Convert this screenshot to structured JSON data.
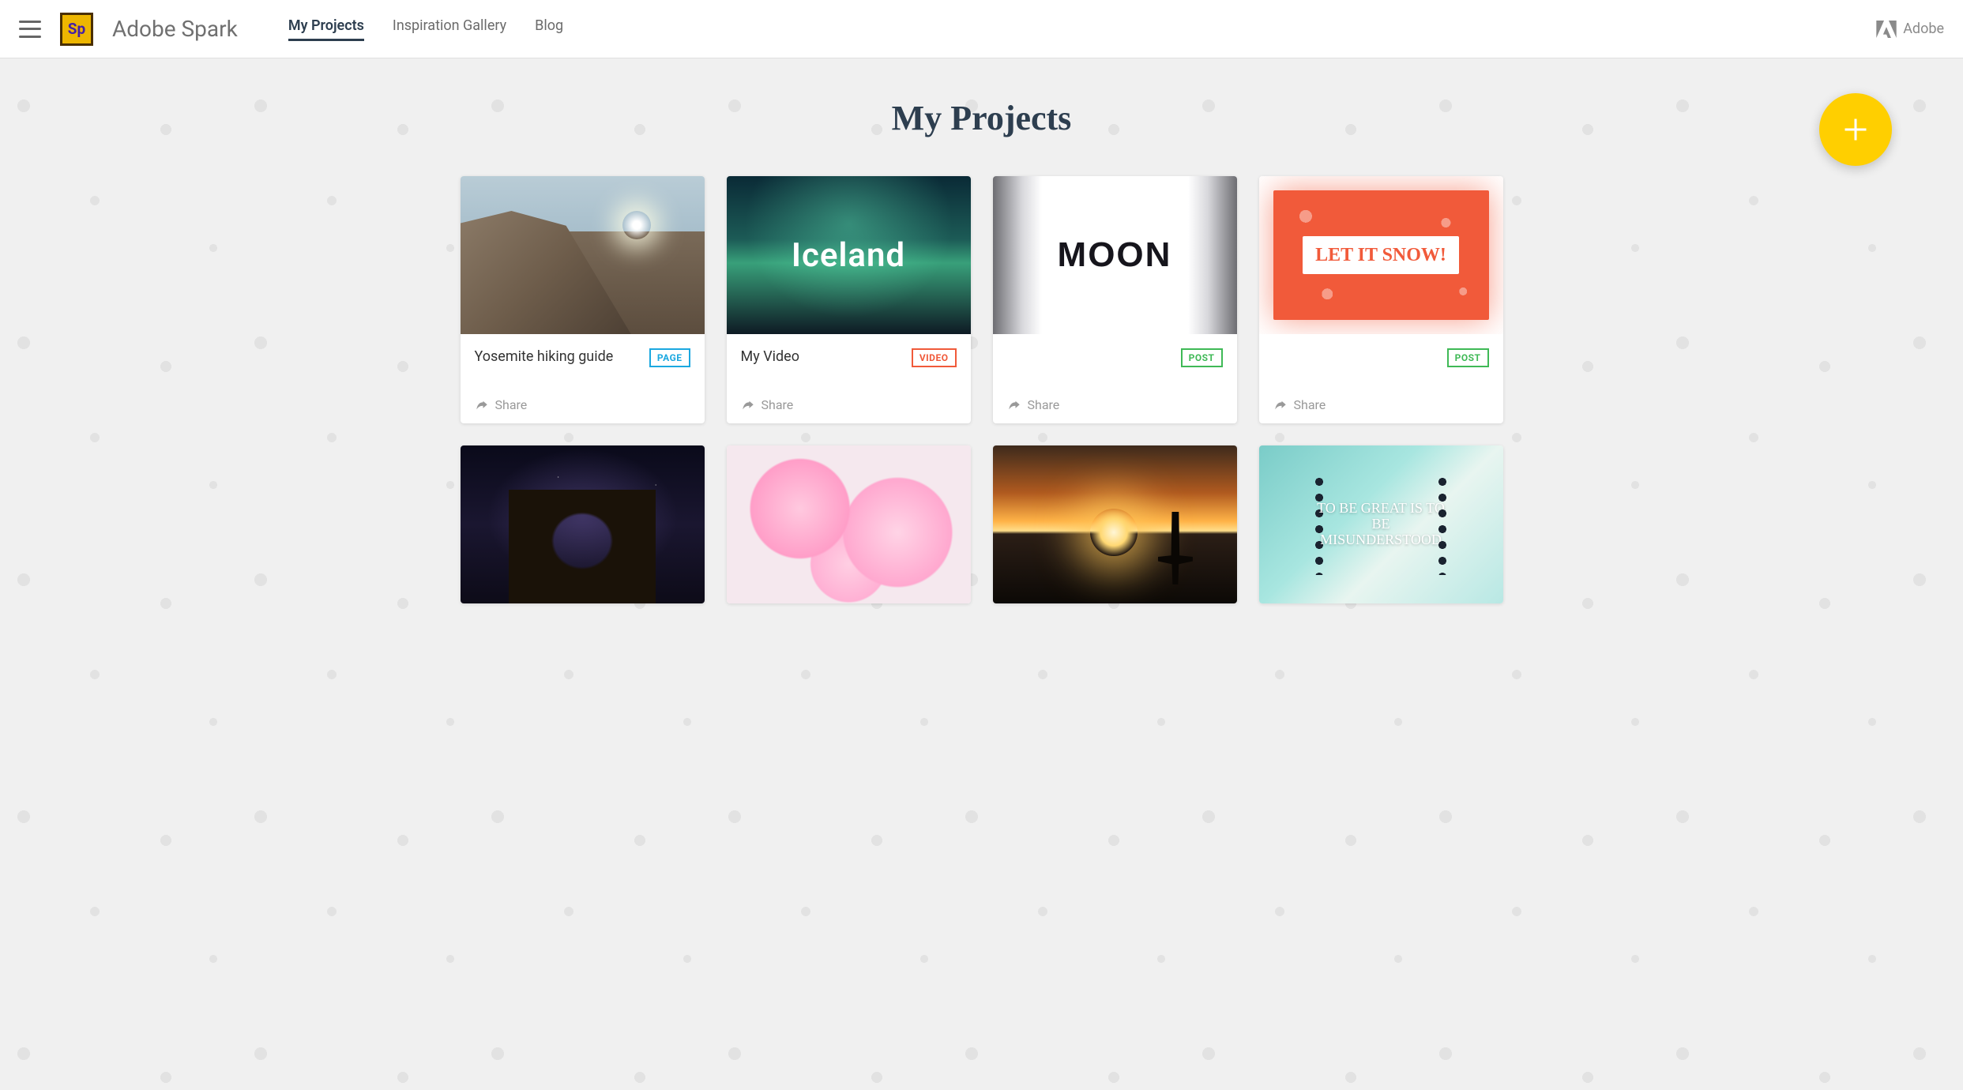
{
  "header": {
    "brand": "Adobe Spark",
    "logo_text": "Sp",
    "nav": [
      {
        "label": "My Projects",
        "active": true
      },
      {
        "label": "Inspiration Gallery",
        "active": false
      },
      {
        "label": "Blog",
        "active": false
      }
    ],
    "adobe_label": "Adobe"
  },
  "page": {
    "title": "My Projects",
    "fab_label": "Create new",
    "share_label": "Share"
  },
  "badges": {
    "page": "PAGE",
    "video": "VIDEO",
    "post": "POST"
  },
  "projects": [
    {
      "title": "Yosemite hiking guide",
      "type": "page",
      "thumb": "yosemite",
      "overlay": ""
    },
    {
      "title": "My Video",
      "type": "video",
      "thumb": "iceland",
      "overlay": "Iceland"
    },
    {
      "title": "",
      "type": "post",
      "thumb": "moon",
      "overlay": "MOON"
    },
    {
      "title": "",
      "type": "post",
      "thumb": "snow",
      "overlay": "LET IT SNOW!"
    },
    {
      "title": "",
      "type": "",
      "thumb": "arch",
      "overlay": ""
    },
    {
      "title": "",
      "type": "",
      "thumb": "flowers",
      "overlay": ""
    },
    {
      "title": "",
      "type": "",
      "thumb": "sunset",
      "overlay": ""
    },
    {
      "title": "",
      "type": "",
      "thumb": "great",
      "overlay": "TO BE GREAT IS TO BE MISUNDERSTOOD"
    }
  ],
  "colors": {
    "accent_yellow": "#ffcf00",
    "heading": "#2d3e4f",
    "badge_page": "#1ba8e0",
    "badge_video": "#f05a3a",
    "badge_post": "#3fb956"
  }
}
